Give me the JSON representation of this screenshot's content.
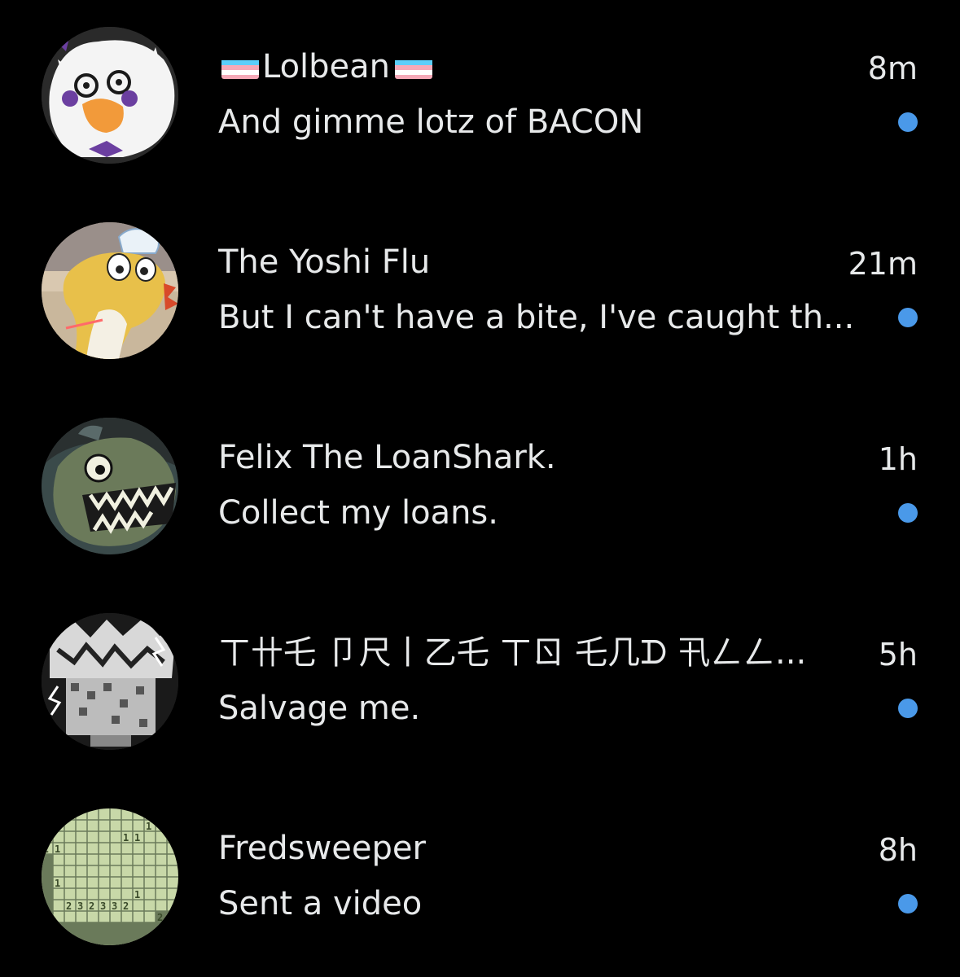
{
  "colors": {
    "background": "#000000",
    "text": "#e7e9ea",
    "unread_dot": "#4a99e9",
    "trans_blue": "#5bcefa",
    "trans_pink": "#f5a9b8",
    "trans_white": "#ffffff"
  },
  "conversations": [
    {
      "name": "Lolbean",
      "name_flags": [
        "transgender-flag-icon",
        "transgender-flag-icon"
      ],
      "time": "8m",
      "preview": "And gimme lotz of BACON",
      "unread": true,
      "avatar": "white-character-avatar"
    },
    {
      "name": "The Yoshi Flu",
      "time": "21m",
      "preview": "But I can't have a bite, I've caught th...",
      "unread": true,
      "avatar": "yellow-dino-avatar"
    },
    {
      "name": "Felix The LoanShark.",
      "time": "1h",
      "preview": "Collect my loans.",
      "unread": true,
      "avatar": "shark-avatar"
    },
    {
      "name": "ㄒ卄乇 卩尺丨乙乇 ㄒㄖ 乇几ᗪ 卂ㄥㄥ...",
      "time": "5h",
      "preview": "Salvage me.",
      "unread": true,
      "avatar": "static-monster-avatar"
    },
    {
      "name": "Fredsweeper",
      "time": "8h",
      "preview": "Sent a video",
      "unread": true,
      "avatar": "minesweeper-avatar"
    }
  ]
}
